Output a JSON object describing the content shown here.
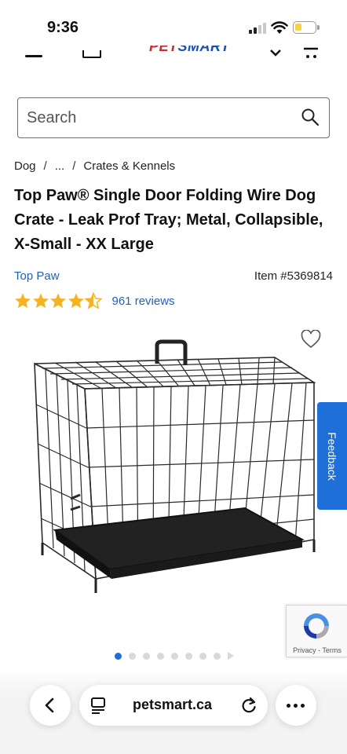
{
  "status_bar": {
    "time": "9:36"
  },
  "header": {
    "logo_text_left": "PET",
    "logo_text_right": "SMART"
  },
  "search": {
    "placeholder": "Search",
    "value": ""
  },
  "breadcrumb": [
    {
      "label": "Dog"
    },
    {
      "label": "..."
    },
    {
      "label": "Crates & Kennels"
    }
  ],
  "breadcrumb_separator": "/",
  "product": {
    "title": "Top Paw® Single Door Folding Wire Dog Crate - Leak Prof Tray; Metal, Collapsible, X-Small - XX Large",
    "brand": "Top Paw",
    "item_number": "Item #5369814",
    "rating": 4.5,
    "reviews": "961 reviews"
  },
  "image_carousel": {
    "total_dots": 8,
    "active_index": 0
  },
  "feedback_tab": {
    "label": "Feedback"
  },
  "recaptcha": {
    "links": "Privacy - Terms"
  },
  "browser": {
    "url": "petsmart.ca"
  },
  "colors": {
    "link": "#1f5fbf",
    "accent": "#1f6fd9",
    "star": "#f5b324"
  },
  "icons": {
    "search": "search-icon",
    "heart": "heart-icon",
    "back": "chevron-left-icon",
    "reload": "reload-icon",
    "more": "more-icon",
    "reader": "reader-icon"
  }
}
